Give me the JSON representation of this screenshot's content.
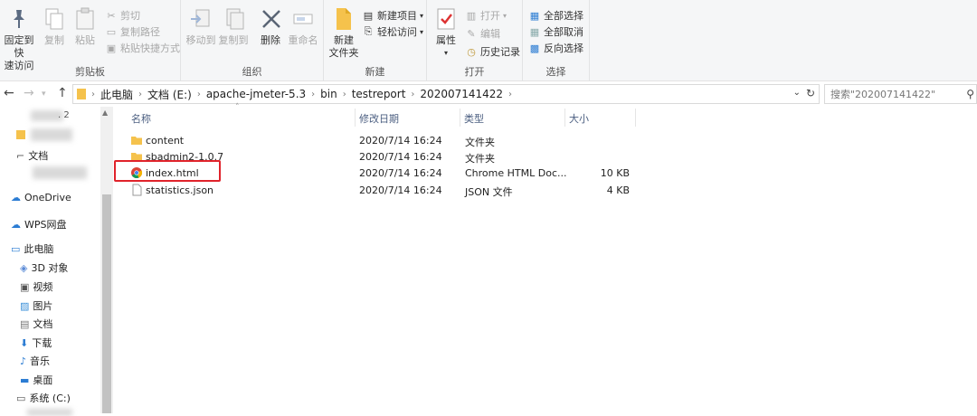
{
  "ribbon": {
    "clipboard": {
      "group_label": "剪贴板",
      "pin_label_1": "固定到快",
      "pin_label_2": "速访问",
      "copy": "复制",
      "paste": "粘贴",
      "cut": "剪切",
      "copy_path": "复制路径",
      "paste_shortcut": "粘贴快捷方式"
    },
    "organize": {
      "group_label": "组织",
      "move_to": "移动到",
      "copy_to": "复制到",
      "delete": "删除",
      "rename": "重命名"
    },
    "new": {
      "group_label": "新建",
      "new_folder_1": "新建",
      "new_folder_2": "文件夹",
      "new_item": "新建项目",
      "easy_access": "轻松访问"
    },
    "open": {
      "group_label": "打开",
      "properties": "属性",
      "open": "打开",
      "edit": "编辑",
      "history": "历史记录"
    },
    "select": {
      "group_label": "选择",
      "select_all": "全部选择",
      "select_none": "全部取消",
      "invert": "反向选择"
    }
  },
  "address": {
    "crumbs": [
      "此电脑",
      "文档 (E:)",
      "apache-jmeter-5.3",
      "bin",
      "testreport",
      "202007141422"
    ],
    "search_placeholder": "搜索\"202007141422\""
  },
  "nav": {
    "items": [
      {
        "label": "文档"
      },
      {
        "label": "OneDrive"
      },
      {
        "label": "WPS网盘"
      },
      {
        "label": "此电脑"
      },
      {
        "label": "3D 对象"
      },
      {
        "label": "视频"
      },
      {
        "label": "图片"
      },
      {
        "label": "文档"
      },
      {
        "label": "下载"
      },
      {
        "label": "音乐"
      },
      {
        "label": "桌面"
      },
      {
        "label": "系统 (C:)"
      }
    ]
  },
  "columns": {
    "name": "名称",
    "date": "修改日期",
    "type": "类型",
    "size": "大小"
  },
  "files": [
    {
      "name": "content",
      "date": "2020/7/14 16:24",
      "type": "文件夹",
      "size": "",
      "icon": "folder-icon"
    },
    {
      "name": "sbadmin2-1.0.7",
      "date": "2020/7/14 16:24",
      "type": "文件夹",
      "size": "",
      "icon": "folder-icon"
    },
    {
      "name": "index.html",
      "date": "2020/7/14 16:24",
      "type": "Chrome HTML Doc...",
      "size": "10 KB",
      "icon": "chrome-icon"
    },
    {
      "name": "statistics.json",
      "date": "2020/7/14 16:24",
      "type": "JSON 文件",
      "size": "4 KB",
      "icon": "file-icon"
    }
  ],
  "colors": {
    "highlight": "#e0232b",
    "folder": "#f5c24c",
    "accent": "#2b7cd3"
  }
}
